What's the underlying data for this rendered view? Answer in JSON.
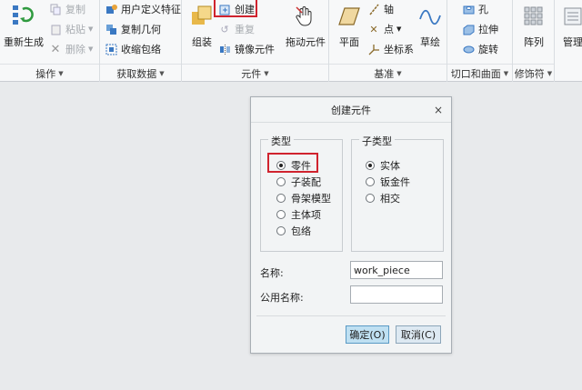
{
  "ribbon": {
    "operations": {
      "regenerate": "重新生成",
      "copy": "复制",
      "paste": "粘贴",
      "delete": "删除",
      "footer": "操作"
    },
    "get_data": {
      "udf": "用户定义特征",
      "copy_geometry": "复制几何",
      "shrinkwrap": "收缩包络",
      "footer": "获取数据"
    },
    "component": {
      "assemble": "组装",
      "create": "创建",
      "repeat": "重复",
      "mirror": "镜像元件",
      "drag": "拖动元件",
      "footer": "元件"
    },
    "datum": {
      "plane": "平面",
      "axis": "轴",
      "point": "点",
      "csys": "坐标系",
      "sketch": "草绘",
      "footer": "基准"
    },
    "cut_surface": {
      "hole": "孔",
      "extrude": "拉伸",
      "revolve": "旋转",
      "footer": "切口和曲面"
    },
    "modifiers": {
      "pattern": "阵列",
      "footer": "修饰符"
    },
    "management": {
      "label": "管理"
    }
  },
  "dialog": {
    "title": "创建元件",
    "close": "×",
    "type_legend": "类型",
    "types": [
      "零件",
      "子装配",
      "骨架模型",
      "主体项",
      "包络"
    ],
    "selected_type": 0,
    "subtype_legend": "子类型",
    "subtypes": [
      "实体",
      "钣金件",
      "相交"
    ],
    "selected_subtype": 0,
    "name_label": "名称:",
    "name_value": "work_piece",
    "common_name_label": "公用名称:",
    "common_name_value": "",
    "ok": "确定(O)",
    "cancel": "取消(C)"
  }
}
